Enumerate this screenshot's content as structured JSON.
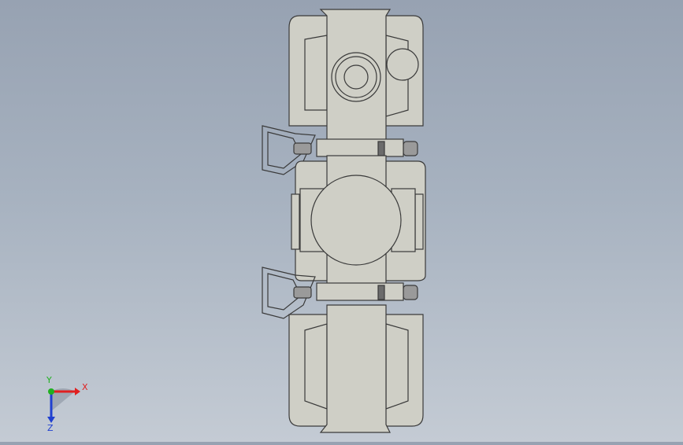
{
  "viewport": {
    "background_top": "#97a2b2",
    "background_bottom": "#c4cbd4"
  },
  "model": {
    "fill": "#cfcfc6",
    "edge": "#3a3a3a",
    "pin": "#9a9a9a"
  },
  "triad": {
    "x_label": "X",
    "y_label": "Y",
    "z_label": "Z",
    "x_color": "#e02020",
    "y_color": "#20b020",
    "z_color": "#2040d0"
  }
}
